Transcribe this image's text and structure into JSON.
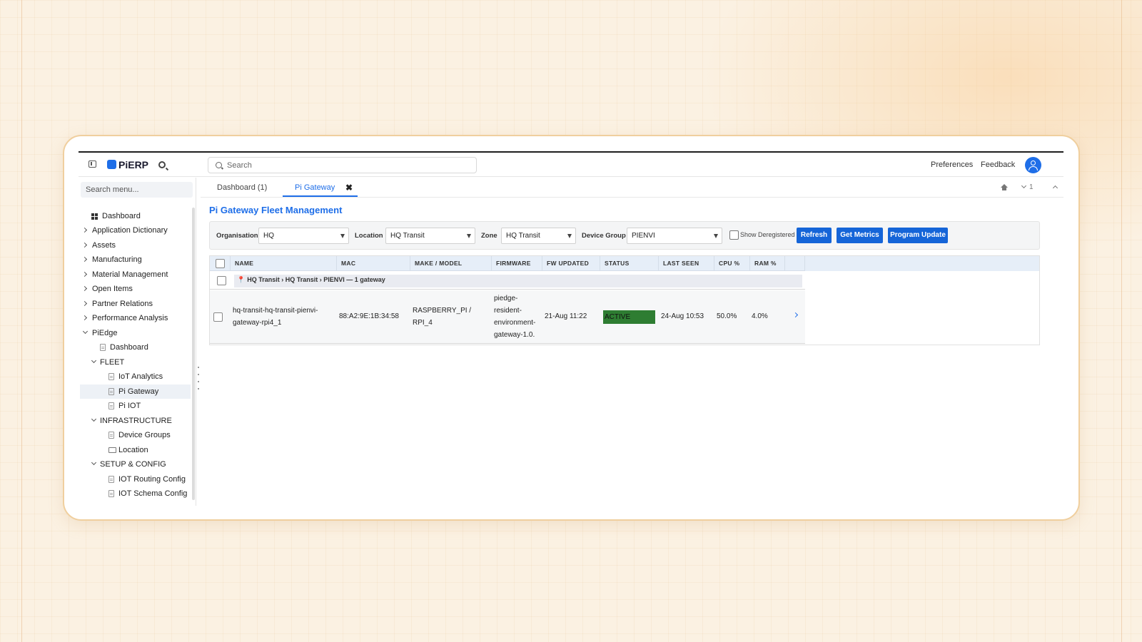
{
  "app": {
    "logo": "PiERP",
    "search_placeholder": "Search",
    "links": {
      "preferences": "Preferences",
      "feedback": "Feedback"
    }
  },
  "sidebar": {
    "search_placeholder": "Search menu...",
    "items": [
      {
        "label": "Dashboard"
      },
      {
        "label": "Application Dictionary"
      },
      {
        "label": "Assets"
      },
      {
        "label": "Manufacturing"
      },
      {
        "label": "Material Management"
      },
      {
        "label": "Open Items"
      },
      {
        "label": "Partner Relations"
      },
      {
        "label": "Performance Analysis"
      },
      {
        "label": "PiEdge"
      },
      {
        "label": "Dashboard"
      },
      {
        "label": "FLEET"
      },
      {
        "label": "IoT Analytics"
      },
      {
        "label": "Pi Gateway"
      },
      {
        "label": "Pi IOT"
      },
      {
        "label": "INFRASTRUCTURE"
      },
      {
        "label": "Device Groups"
      },
      {
        "label": "Location"
      },
      {
        "label": "SETUP & CONFIG"
      },
      {
        "label": "IOT Routing Config"
      },
      {
        "label": "IOT Schema Config"
      }
    ]
  },
  "tabs": [
    {
      "label": "Dashboard (1)"
    },
    {
      "label": "Pi Gateway"
    }
  ],
  "tab_close": "✖",
  "version": "1",
  "page": {
    "title": "Pi Gateway Fleet Management"
  },
  "filters": {
    "organisation": {
      "label": "Organisation",
      "value": "HQ"
    },
    "location": {
      "label": "Location",
      "value": "HQ Transit"
    },
    "zone": {
      "label": "Zone",
      "value": "HQ Transit"
    },
    "device_group": {
      "label": "Device Group",
      "value": "PIENVI"
    },
    "show_deregistered": "Show Deregistered",
    "buttons": {
      "refresh": "Refresh",
      "get_metrics": "Get Metrics",
      "program_update": "Program Update"
    }
  },
  "table": {
    "columns": [
      "NAME",
      "MAC",
      "MAKE / MODEL",
      "FIRMWARE",
      "FW UPDATED",
      "STATUS",
      "LAST SEEN",
      "CPU %",
      "RAM %"
    ],
    "group": "HQ Transit › HQ Transit › PIENVI — 1 gateway",
    "group_icon": "📍",
    "rows": [
      {
        "name_1": "hq-transit-hq-transit-pienvi-",
        "name_2": "gateway-rpi4_1",
        "mac": "88:A2:9E:1B:34:58",
        "model_1": "RASPBERRY_PI /",
        "model_2": "RPI_4",
        "fw_1": "piedge-",
        "fw_2": "resident-",
        "fw_3": "environment-",
        "fw_4": "gateway-1.0.",
        "fw_updated": "21-Aug 11:22",
        "status": "ACTIVE",
        "last_seen": "24-Aug 10:53",
        "cpu": "50.0%",
        "ram": "4.0%"
      }
    ]
  },
  "colors": {
    "accent": "#1e6ee8",
    "status_active": "#2e7d32",
    "header_bg": "#e6eef8"
  }
}
